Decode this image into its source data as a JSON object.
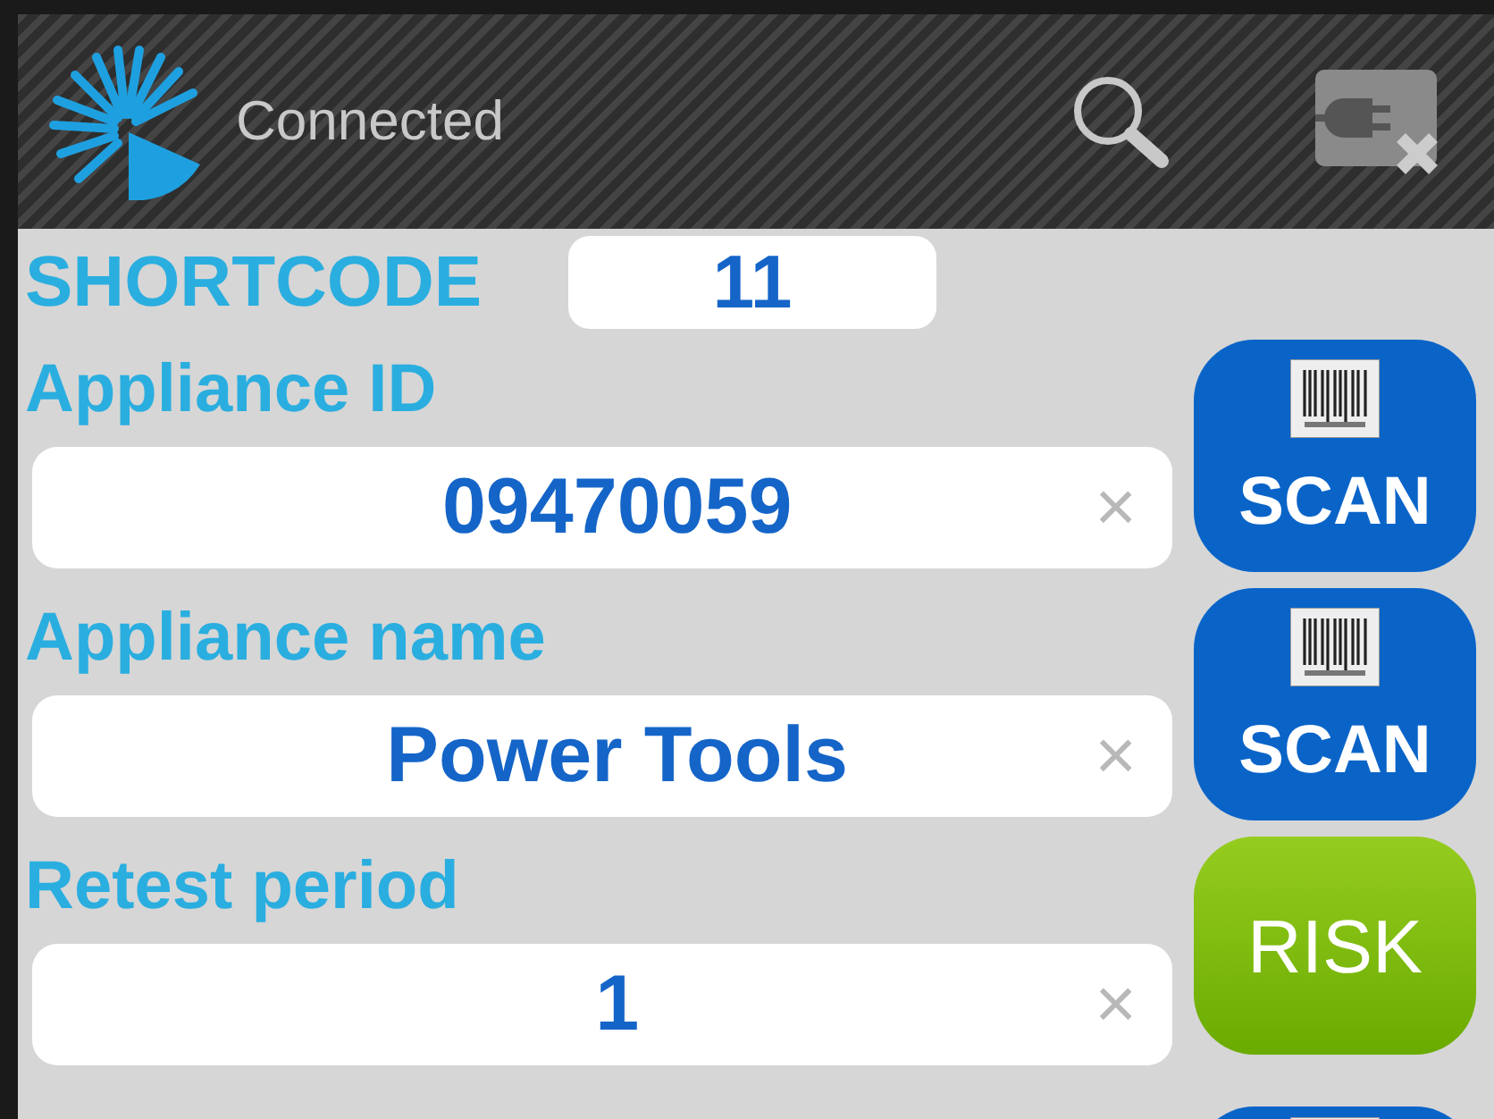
{
  "header": {
    "status": "Connected"
  },
  "shortcode": {
    "label": "SHORTCODE",
    "value": "11"
  },
  "fields": [
    {
      "label": "Appliance ID",
      "value": "09470059",
      "clear": "×",
      "button": {
        "kind": "scan",
        "label": "SCAN"
      }
    },
    {
      "label": "Appliance name",
      "value": "Power Tools",
      "clear": "×",
      "button": {
        "kind": "scan",
        "label": "SCAN"
      }
    },
    {
      "label": "Retest period",
      "value": "1",
      "clear": "×",
      "button": {
        "kind": "risk",
        "label": "RISK"
      }
    }
  ],
  "next_button": {
    "kind": "scan"
  }
}
